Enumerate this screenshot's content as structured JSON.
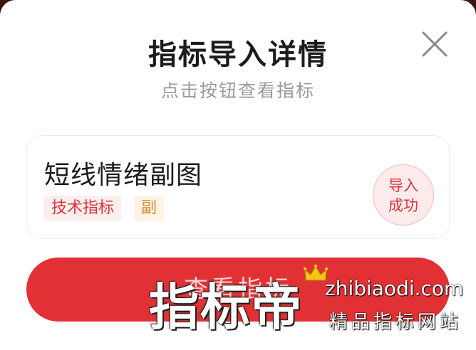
{
  "dialog": {
    "title": "指标导入详情",
    "subtitle": "点击按钮查看指标"
  },
  "close_icon": "close-icon",
  "indicator_card": {
    "name": "短线情绪副图",
    "tags": [
      "技术指标",
      "副"
    ],
    "status_line1": "导入",
    "status_line2": "成功"
  },
  "action_button": {
    "label": "查看指标"
  },
  "watermark": {
    "title": "指标帝",
    "domain": "zhibiaodi.com",
    "slogan": "精品指标网站",
    "crown_icon": "crown-icon"
  },
  "colors": {
    "accent": "#e23134",
    "tag_tech_bg": "#fdeeee",
    "tag_tech_text": "#d9343a",
    "tag_sub_bg": "#fdf3e6",
    "tag_sub_text": "#d98b2b",
    "stamp_bg": "#fdebeb"
  }
}
